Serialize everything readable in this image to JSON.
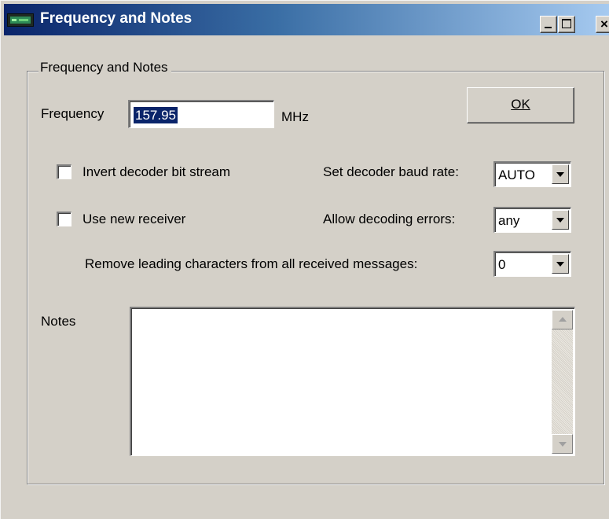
{
  "window": {
    "title": "Frequency and Notes",
    "icon": "radio-scanner-icon",
    "controls": {
      "minimize": "minimize-icon",
      "maximize": "maximize-icon",
      "close": "×"
    }
  },
  "group": {
    "legend": "Frequency and Notes"
  },
  "frequency": {
    "label": "Frequency",
    "value": "157.95",
    "unit": "MHz"
  },
  "ok_button": {
    "label": "OK"
  },
  "options": {
    "invert_decoder": {
      "label": "Invert decoder bit stream",
      "checked": false
    },
    "use_new_receiver": {
      "label": "Use new receiver",
      "checked": false
    }
  },
  "baud_rate": {
    "label": "Set decoder baud rate:",
    "value": "AUTO"
  },
  "decoding_errors": {
    "label": "Allow decoding errors:",
    "value": "any"
  },
  "remove_leading": {
    "label": "Remove leading characters from all received messages:",
    "value": "0"
  },
  "notes": {
    "label": "Notes",
    "value": ""
  },
  "colors": {
    "title_start": "#0a246a",
    "title_end": "#a6caf0",
    "face": "#d4d0c8",
    "selection": "#0a246a"
  }
}
